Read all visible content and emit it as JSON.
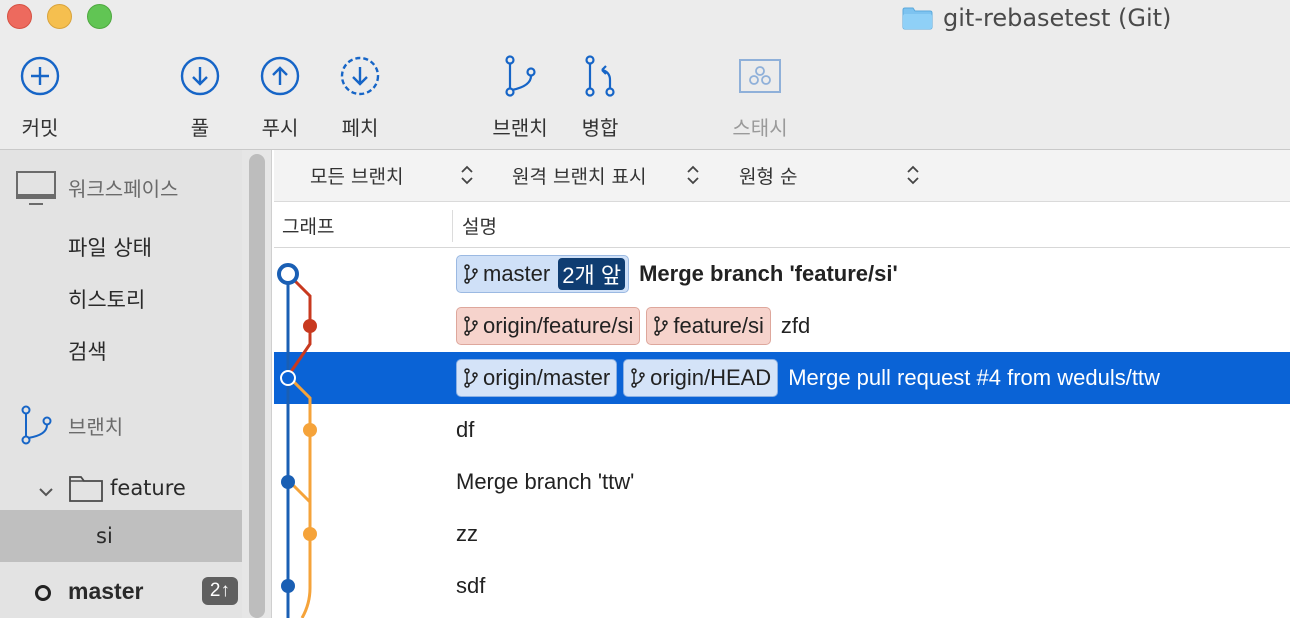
{
  "window": {
    "title": "git-rebasetest (Git)"
  },
  "toolbar": {
    "commit": {
      "label": "커밋",
      "icon": "plus-circle-icon"
    },
    "pull": {
      "label": "풀",
      "icon": "arrow-down-circle-icon"
    },
    "push": {
      "label": "푸시",
      "icon": "arrow-up-circle-icon"
    },
    "fetch": {
      "label": "페치",
      "icon": "dashed-arrow-down-circle-icon"
    },
    "branch": {
      "label": "브랜치",
      "icon": "branch-icon"
    },
    "merge": {
      "label": "병합",
      "icon": "merge-icon"
    },
    "stash": {
      "label": "스태시",
      "icon": "stash-icon",
      "enabled": false
    }
  },
  "sidebar": {
    "workspace": {
      "label": "워크스페이스",
      "icon": "monitor-icon"
    },
    "workspace_items": [
      {
        "label": "파일 상태"
      },
      {
        "label": "히스토리"
      },
      {
        "label": "검색"
      }
    ],
    "branches": {
      "label": "브랜치",
      "icon": "branch-icon"
    },
    "folder": {
      "label": "feature",
      "icon": "folder-icon",
      "expanded": true
    },
    "feature_branch": {
      "label": "si"
    },
    "current_branch": {
      "label": "master",
      "badge": "2↑"
    }
  },
  "filters": {
    "branches": "모든 브랜치",
    "remote": "원격 브랜치 표시",
    "order": "원형 순"
  },
  "columns": {
    "graph": "그래프",
    "description": "설명"
  },
  "commits": [
    {
      "tags": [
        {
          "name": "master",
          "color": "blue",
          "ahead": "2개 앞"
        }
      ],
      "message": "Merge branch 'feature/si'",
      "bold": true
    },
    {
      "tags": [
        {
          "name": "origin/feature/si",
          "color": "red"
        },
        {
          "name": "feature/si",
          "color": "red"
        }
      ],
      "message": "zfd"
    },
    {
      "tags": [
        {
          "name": "origin/master",
          "color": "blue"
        },
        {
          "name": "origin/HEAD",
          "color": "blue"
        }
      ],
      "message": "Merge pull request #4 from weduls/ttw",
      "selected": true
    },
    {
      "tags": [],
      "message": "df"
    },
    {
      "tags": [],
      "message": "Merge branch 'ttw'"
    },
    {
      "tags": [],
      "message": "zz"
    },
    {
      "tags": [],
      "message": "sdf"
    }
  ],
  "colors": {
    "accent": "#0a63d6",
    "graph_blue": "#1a5fb4",
    "graph_red": "#c8391f",
    "graph_orange": "#f5a33a",
    "tag_blue_bg": "#cfe0f7",
    "tag_red_bg": "#f6d3cc"
  }
}
